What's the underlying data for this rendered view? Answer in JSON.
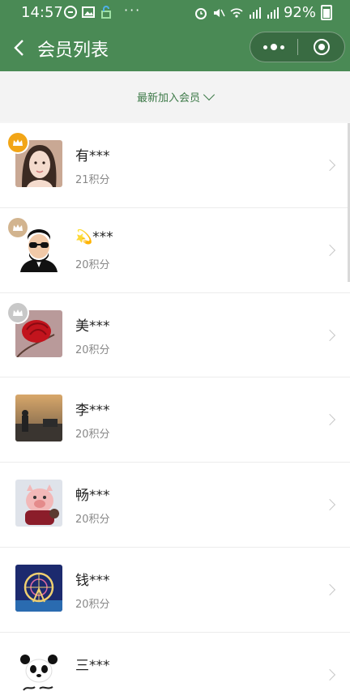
{
  "status_bar": {
    "time": "14:57",
    "battery": "92%",
    "icons": [
      "message-icon",
      "image-icon",
      "lock-icon",
      "alarm-icon",
      "mute-icon",
      "wifi-icon",
      "signal-4g-icon",
      "signal-icon",
      "battery-icon"
    ]
  },
  "nav": {
    "title": "会员列表"
  },
  "colors": {
    "brand_green": "#4a8a55",
    "filter_green": "#3d7a48",
    "crown_gold": "#f2a516",
    "crown_bronze": "#d2b48f",
    "crown_silver": "#c8c8c8"
  },
  "filter": {
    "label": "最新加入会员"
  },
  "members": [
    {
      "name": "有***",
      "points": "21积分",
      "crown": "gold"
    },
    {
      "name": "💫***",
      "points": "20积分",
      "crown": "bronze"
    },
    {
      "name": "美***",
      "points": "20积分",
      "crown": "silver"
    },
    {
      "name": "李***",
      "points": "20积分"
    },
    {
      "name": "畅***",
      "points": "20积分"
    },
    {
      "name": "钱***",
      "points": "20积分"
    },
    {
      "name": "三***",
      "points": ""
    }
  ]
}
